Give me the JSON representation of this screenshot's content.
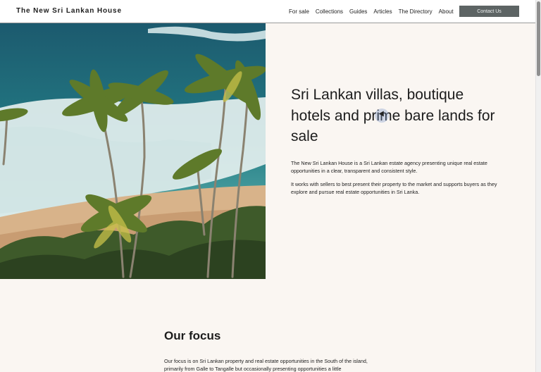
{
  "header": {
    "brand": "The New Sri Lankan House",
    "nav": [
      "For sale",
      "Collections",
      "Guides",
      "Articles",
      "The Directory",
      "About"
    ],
    "cta": "Contact Us"
  },
  "hero": {
    "title": "Sri Lankan villas, boutique hotels and prime bare lands for sale",
    "paragraph1": "The New Sri Lankan House is a Sri Lankan estate agency presenting unique real estate opportunities in a clear, transparent and consistent style.",
    "paragraph2": "It works with sellers to best present their property to the market and supports buyers as they explore and pursue real estate opportunities in Sri Lanka.",
    "image": "aerial-beach-palms-photo"
  },
  "focus": {
    "title": "Our focus",
    "paragraph": "Our focus is on Sri Lankan property and real estate opportunities in the South of the island, primarily from Galle to Tangalle but occasionally presenting opportunities a little"
  },
  "colors": {
    "background": "#faf6f2",
    "cta_bg": "#5d6464",
    "ocean": "#1f5f72",
    "sand": "#d9b48c",
    "foliage": "#3e5a2a"
  }
}
